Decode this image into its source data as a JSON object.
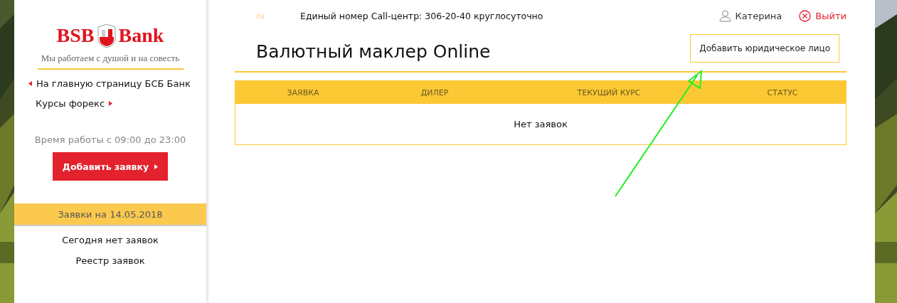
{
  "sidebar": {
    "logo": {
      "left": "BSB",
      "right": "Bank",
      "slogan": "Мы работаем с душой и на совесть"
    },
    "links": [
      {
        "label": "На главную страницу БСБ Банк",
        "arrow_before": true,
        "arrow_after": false
      },
      {
        "label": "Курсы форекс",
        "arrow_before": false,
        "arrow_after": true
      }
    ],
    "hours": "Время работы с 09:00 до 23:00",
    "add_button": "Добавить заявку",
    "date_header": "Заявки на 14.05.2018",
    "items": [
      "Сегодня нет заявок",
      "Реестр заявок"
    ]
  },
  "top_bar": {
    "language": "ru",
    "call_center": "Единый номер Call-центр: 306-20-40 круглосуточно",
    "user": "Катерина",
    "logout": "Выйти"
  },
  "title": "Валютный маклер Online",
  "add_entity_button": "Добавить юридическое лицо",
  "table": {
    "columns": [
      "ЗАЯВКА",
      "ДИЛЕР",
      "ТЕКУЩИЙ КУРС",
      "СТАТУС"
    ],
    "empty_message": "Нет заявок"
  }
}
